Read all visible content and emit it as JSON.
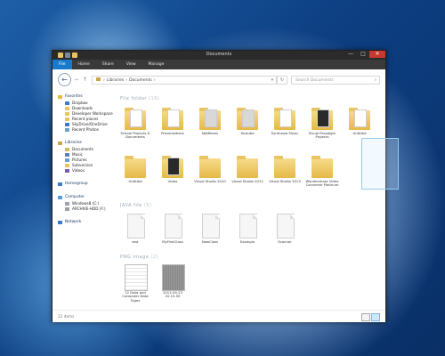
{
  "window": {
    "title": "Documents",
    "ribbon_tabs": [
      "File",
      "Home",
      "Share",
      "View",
      "Manage"
    ],
    "controls": {
      "minimize": "—",
      "maximize": "□",
      "close": "✕"
    }
  },
  "address": {
    "back_icon": "arrow-left-icon",
    "path": [
      "Libraries",
      "Documents"
    ],
    "separator": "›",
    "search_placeholder": "Search Documents"
  },
  "nav": {
    "favorites_header": "Favorites",
    "favorites": [
      "Dropbox",
      "Downloads",
      "Developer Workspace",
      "Recent places",
      "SkyDrive/OneDrive",
      "Recent Photos"
    ],
    "libraries_header": "Libraries",
    "libraries": [
      "Documents",
      "Music",
      "Pictures",
      "Subversion",
      "Videos"
    ],
    "homegroup": "Homegroup",
    "computer_header": "Computer",
    "computer_items": [
      "Windows8 (C:)",
      "ARCHIVE-HDD (F:)"
    ],
    "network": "Network"
  },
  "content": {
    "groups": {
      "folders": {
        "label": "File folder",
        "count": "(15)"
      },
      "files": {
        "label": "JAVA file",
        "count": "(5)"
      },
      "images": {
        "label": "PNG image",
        "count": "(2)"
      }
    },
    "folders": [
      "School Projects & Documents",
      "Presentations",
      "NetBeans",
      "Youtube",
      "Synthesia Music",
      "Visual Paradigm Projects",
      "Untitled",
      "Untitled",
      "Video",
      "Visual Studio 2010",
      "Visual Studio 2012",
      "Visual Studio 2013",
      "Wondershare Video Converter Platinum"
    ],
    "files": [
      "test",
      "MyFirstClass",
      "NewClass",
      "Example",
      "Scanner"
    ],
    "images": [
      "12 Data and Computer Data Types",
      "2012-09-23 20.15.50"
    ]
  },
  "status": {
    "summary": "22 items",
    "view_icons": [
      "details-view-icon",
      "large-icons-view-icon"
    ]
  }
}
